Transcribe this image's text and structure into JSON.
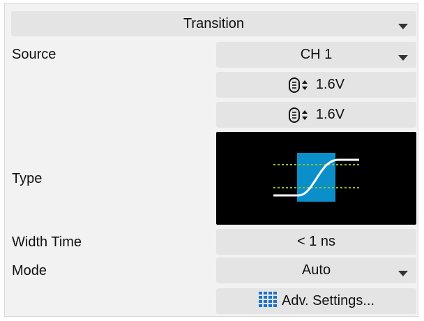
{
  "trigger_type": {
    "value": "Transition"
  },
  "source": {
    "label": "Source",
    "value": "CH 1"
  },
  "level_upper": {
    "value": "1.6V",
    "icon": "level-knob-icon"
  },
  "level_lower": {
    "value": "1.6V",
    "icon": "level-knob-icon"
  },
  "type": {
    "label": "Type",
    "icon": "transition-rising-icon"
  },
  "width_time": {
    "label": "Width Time",
    "value": "< 1 ns"
  },
  "mode": {
    "label": "Mode",
    "value": "Auto"
  },
  "adv_settings": {
    "label": "Adv. Settings...",
    "icon": "grid-icon"
  },
  "colors": {
    "panel": "#f2f2f2",
    "control": "#e4e4e4",
    "type_bg": "#000000",
    "highlight": "#0a8fcb",
    "threshold": "#8fc31f",
    "waveform": "#ffffff"
  }
}
